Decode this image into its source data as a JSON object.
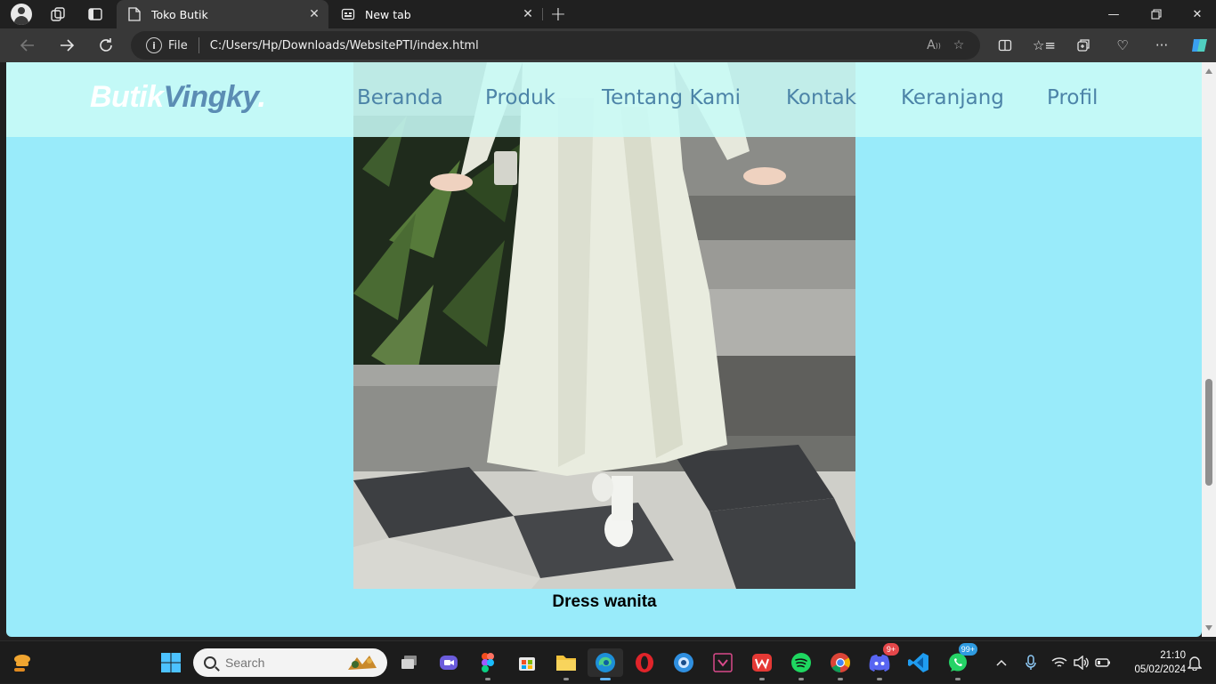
{
  "browser": {
    "tabs": [
      {
        "title": "Toko Butik",
        "active": true
      },
      {
        "title": "New tab",
        "active": false
      }
    ],
    "address": {
      "scheme_label": "File",
      "url": "C:/Users/Hp/Downloads/WebsitePTI/index.html"
    }
  },
  "site": {
    "logo": {
      "part1": "Butik",
      "part2": "Vingky",
      "dot": "."
    },
    "menu": [
      "Beranda",
      "Produk",
      "Tentang Kami",
      "Kontak",
      "Keranjang",
      "Profil"
    ],
    "product_caption": "Dress wanita",
    "colors": {
      "page_bg": "#99ebfa",
      "nav_bg": "#c8faf6",
      "nav_text": "#4c84a8"
    }
  },
  "taskbar": {
    "search_placeholder": "Search",
    "discord_badge": "9+",
    "whatsapp_badge": "99+",
    "time": "21:10",
    "date": "05/02/2024"
  }
}
